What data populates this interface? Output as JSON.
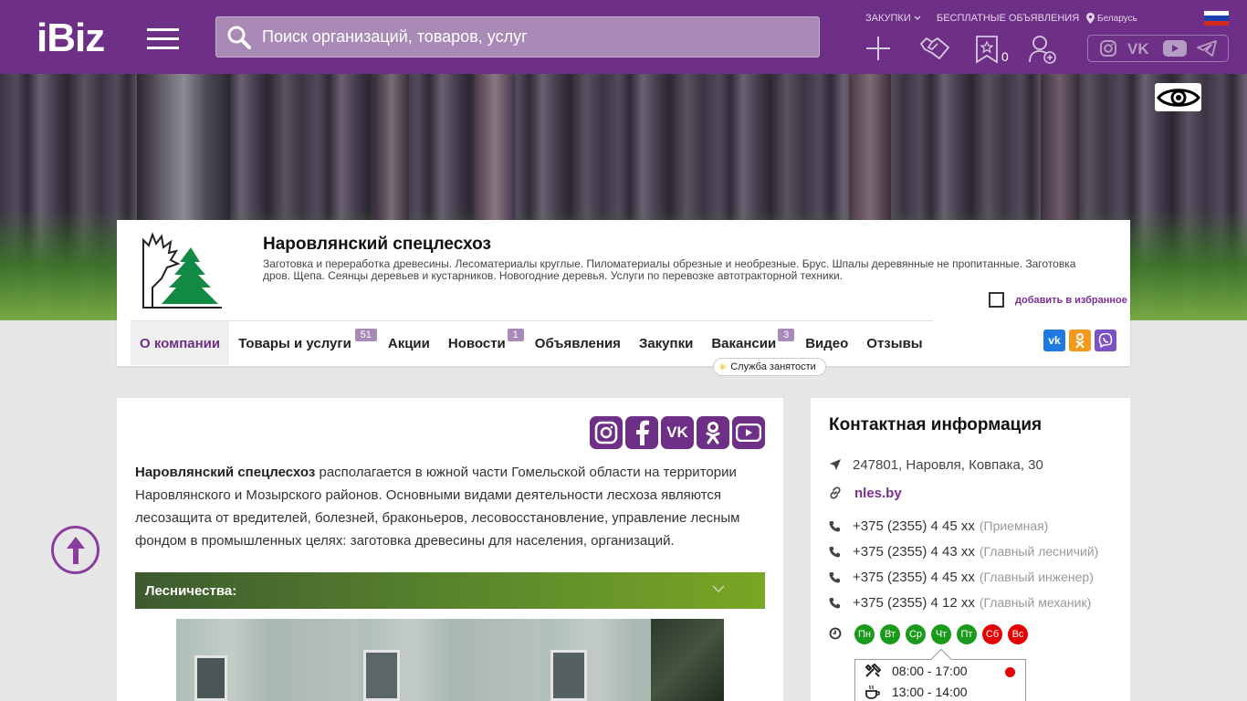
{
  "header": {
    "logo": "iBiz",
    "search_placeholder": "Поиск организаций, товаров, услуг",
    "nav": {
      "purchases": "ЗАКУПКИ",
      "free_ads": "БЕСПЛАТНЫЕ ОБЪЯВЛЕНИЯ",
      "region": "Беларусь"
    },
    "favorites_count": "0",
    "icons": [
      "plus-icon",
      "handshake-icon",
      "favorites-star-icon",
      "add-user-icon"
    ],
    "socials": [
      "instagram-icon",
      "vk-icon",
      "youtube-icon",
      "telegram-icon"
    ]
  },
  "company": {
    "name": "Наровлянский спецлесхоз",
    "description": "Заготовка и переработка древесины. Лесоматериалы круглые. Пиломатериалы обрезные и необрезные. Брус. Шпалы деревянные не пропитанные. Заготовка дров. Щепа. Сеянцы деревьев и кустарников. Новогодние деревья. Услуги по перевозке автотракторной техники.",
    "add_favorite": "добавить в избранное"
  },
  "tabs": [
    {
      "label": "О компании",
      "badge": ""
    },
    {
      "label": "Товары и услуги",
      "badge": "51"
    },
    {
      "label": "Акции",
      "badge": ""
    },
    {
      "label": "Новости",
      "badge": "1"
    },
    {
      "label": "Объявления",
      "badge": ""
    },
    {
      "label": "Закупки",
      "badge": ""
    },
    {
      "label": "Вакансии",
      "badge": "3"
    },
    {
      "label": "Видео",
      "badge": ""
    },
    {
      "label": "Отзывы",
      "badge": ""
    }
  ],
  "vacancy_tooltip": "Служба занятости",
  "about": {
    "company_bold": "Наровлянский спецлесхоз",
    "text": " располагается в южной части Гомельской области на территории Наровлянского и Мозырского районов. Основными видами деятельности лесхоза являются лесозащита от вредителей, болезней, браконьеров, лесовосстановление, управление лесным фондом в промышленных целях: заготовка древесины для населения, организаций.",
    "accordion_title": "Лесничества:"
  },
  "contact": {
    "title": "Контактная информация",
    "address": "247801, Наровля, Ковпака, 30",
    "website": "nles.by",
    "phones": [
      {
        "number": "+375 (2355) 4 45 xx",
        "note": "(Приемная)"
      },
      {
        "number": "+375 (2355) 4 43 xx",
        "note": "(Главный лесничий)"
      },
      {
        "number": "+375 (2355) 4 45 xx",
        "note": "(Главный инженер)"
      },
      {
        "number": "+375 (2355) 4 12 xx",
        "note": "(Главный механик)"
      }
    ],
    "days": [
      {
        "label": "Пн",
        "color": "#1a9a1a"
      },
      {
        "label": "Вт",
        "color": "#1a9a1a"
      },
      {
        "label": "Ср",
        "color": "#1a9a1a"
      },
      {
        "label": "Чт",
        "color": "#1a9a1a"
      },
      {
        "label": "Пт",
        "color": "#1a9a1a"
      },
      {
        "label": "Сб",
        "color": "#e30000"
      },
      {
        "label": "Вс",
        "color": "#e30000"
      }
    ],
    "work_hours": "08:00 - 17:00",
    "lunch_hours": "13:00 - 14:00"
  },
  "colors": {
    "brand": "#6e2f86",
    "accent": "#7a2e90",
    "open_day": "#1a9a1a",
    "closed_day": "#e30000"
  }
}
